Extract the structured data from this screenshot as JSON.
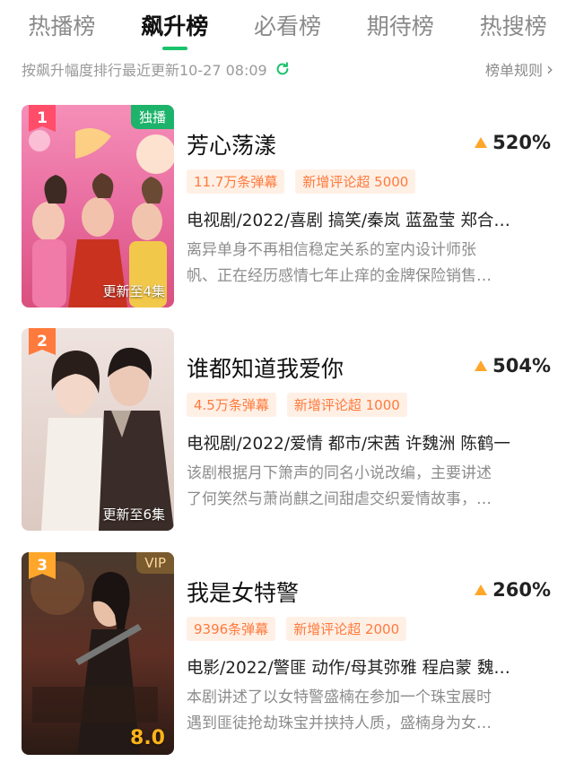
{
  "tabs": [
    {
      "label": "热播榜"
    },
    {
      "label": "飙升榜"
    },
    {
      "label": "必看榜"
    },
    {
      "label": "期待榜"
    },
    {
      "label": "热搜榜"
    }
  ],
  "subheader": {
    "text": "按飙升幅度排行最近更新10-27 08:09",
    "rules_label": "榜单规则",
    "rules_arrow": "›"
  },
  "colors": {
    "accent_green": "#19c26b",
    "rank1": "#ff4d6a",
    "rank2": "#ff7a3c",
    "rank3": "#ffa62b",
    "badge_text": "#ff7a3c",
    "growth_triangle": "#ffa62b"
  },
  "items": [
    {
      "rank": "1",
      "corner_tag": "独播",
      "poster_footer": "更新至4集",
      "title": "芳心荡漾",
      "growth": "520%",
      "danmu": "11.7万条弹幕",
      "comments": "新增评论超 5000",
      "meta": "电视剧/2022/喜剧 搞笑/秦岚 蓝盈莹 郑合…",
      "desc_line1": "离异单身不再相信稳定关系的室内设计师张",
      "desc_line2": "帆、正在经历感情七年止痒的金牌保险销售…"
    },
    {
      "rank": "2",
      "corner_tag": "",
      "poster_footer": "更新至6集",
      "title": "谁都知道我爱你",
      "growth": "504%",
      "danmu": "4.5万条弹幕",
      "comments": "新增评论超 1000",
      "meta": "电视剧/2022/爱情 都市/宋茜 许魏洲 陈鹤一",
      "desc_line1": "该剧根据月下箫声的同名小说改编，主要讲述",
      "desc_line2": "了何笑然与萧尚麒之间甜虐交织爱情故事，…"
    },
    {
      "rank": "3",
      "corner_tag": "VIP",
      "poster_footer": "8.0",
      "title": "我是女特警",
      "growth": "260%",
      "danmu": "9396条弹幕",
      "comments": "新增评论超 2000",
      "meta": "电影/2022/警匪 动作/母其弥雅 程启蒙 魏…",
      "desc_line1": "本剧讲述了以女特警盛楠在参加一个珠宝展时",
      "desc_line2": "遇到匪徒抢劫珠宝并挟持人质，盛楠身为女…"
    }
  ]
}
